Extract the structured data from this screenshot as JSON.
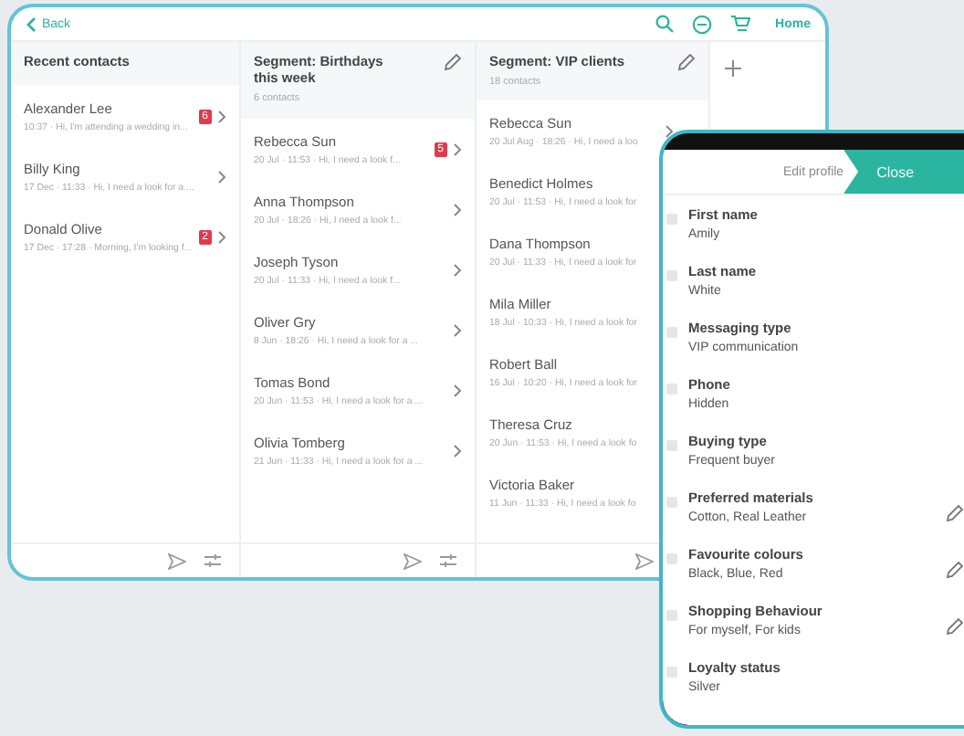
{
  "tablet": {
    "back": "Back",
    "home": "Home",
    "columns": [
      {
        "title": "Recent contacts",
        "editable": false,
        "rows": [
          {
            "name": "Alexander Lee",
            "preview": "10:37 · Hi, I'm attending a wedding in...",
            "badge": "6",
            "chevron": true
          },
          {
            "name": "Billy King",
            "preview": "17 Dec · 11:33 · Hi, I need a look for a ...",
            "chevron": true
          },
          {
            "name": "Donald Olive",
            "preview": "17 Dec · 17:28 · Morning, I'm looking f...",
            "badge": "2",
            "chevron": true
          }
        ]
      },
      {
        "title": "Segment: Birthdays this week",
        "subtitle": "6 contacts",
        "editable": true,
        "rows": [
          {
            "name": "Rebecca Sun",
            "preview": "20 Jul · 11:53 · Hi, I need a look f...",
            "badge": "5",
            "chevron": true
          },
          {
            "name": "Anna Thompson",
            "preview": "20 Jul · 18:26 · Hi, I need a look f...",
            "chevron": true
          },
          {
            "name": "Joseph Tyson",
            "preview": "20 Jul · 11:33 · Hi, I need a look f...",
            "chevron": true
          },
          {
            "name": "Oliver Gry",
            "preview": "8 Jun · 18:26 · Hi, I need a look for a ...",
            "chevron": true
          },
          {
            "name": "Tomas Bond",
            "preview": "20 Jun · 11:53 · Hi, I need a look for a ...",
            "chevron": true
          },
          {
            "name": "Olivia Tomberg",
            "preview": "21 Jun · 11:33 · Hi, I need a look for a ...",
            "chevron": true
          }
        ]
      },
      {
        "title": "Segment: VIP clients",
        "subtitle": "18 contacts",
        "editable": true,
        "rows": [
          {
            "name": "Rebecca Sun",
            "preview": "20 Jul Aug · 18:26 · Hi, I need a loo",
            "chevron": true
          },
          {
            "name": "Benedict Holmes",
            "preview": "20 Jul · 11:53 · Hi, I need a look for",
            "chevron": false
          },
          {
            "name": "Dana Thompson",
            "preview": "20 Jul · 11:33 · Hi, I need a look for",
            "chevron": false
          },
          {
            "name": "Mila Miller",
            "preview": "18 Jul · 10:33 · Hi, I need a look for",
            "chevron": false
          },
          {
            "name": "Robert Ball",
            "preview": "16 Jul · 10:20 · Hi, I need a look for",
            "chevron": false
          },
          {
            "name": "Theresa Cruz",
            "preview": "20 Jun · 11:53 · Hi, I need a look fo",
            "chevron": false
          },
          {
            "name": "Victoria Baker",
            "preview": "11 Jun · 11:33 · Hi, I need a look fo",
            "chevron": false
          }
        ]
      }
    ]
  },
  "phone": {
    "title": "Edit profile",
    "close": "Close",
    "fields": [
      {
        "label": "First name",
        "value": "Amily",
        "editable": false
      },
      {
        "label": "Last name",
        "value": "White",
        "editable": false
      },
      {
        "label": "Messaging type",
        "value": "VIP communication",
        "editable": false
      },
      {
        "label": "Phone",
        "value": "Hidden",
        "editable": false
      },
      {
        "label": "Buying type",
        "value": "Frequent buyer",
        "editable": false
      },
      {
        "label": "Preferred materials",
        "value": "Cotton, Real Leather",
        "editable": true
      },
      {
        "label": "Favourite colours",
        "value": "Black, Blue, Red",
        "editable": true
      },
      {
        "label": "Shopping Behaviour",
        "value": "For myself, For kids",
        "editable": true
      },
      {
        "label": "Loyalty status",
        "value": "Silver",
        "editable": false
      }
    ]
  }
}
